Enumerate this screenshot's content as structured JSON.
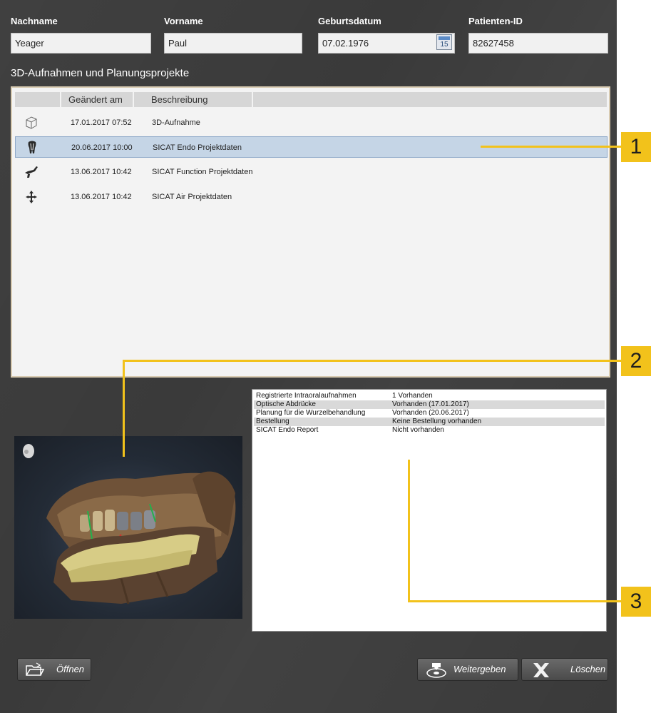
{
  "patient": {
    "lastname_label": "Nachname",
    "lastname_value": "Yeager",
    "firstname_label": "Vorname",
    "firstname_value": "Paul",
    "birthdate_label": "Geburtsdatum",
    "birthdate_value": "07.02.1976",
    "calendar_day": "15",
    "patient_id_label": "Patienten-ID",
    "patient_id_value": "82627458"
  },
  "projects": {
    "title": "3D-Aufnahmen und Planungsprojekte",
    "columns": [
      "Geändert am",
      "Beschreibung"
    ],
    "rows": [
      {
        "icon": "3d-volume-cube-icon",
        "date": "17.01.2017 07:52",
        "description": "3D-Aufnahme",
        "selected": false
      },
      {
        "icon": "tooth-endo-icon",
        "date": "20.06.2017 10:00",
        "description": "SICAT Endo Projektdaten",
        "selected": true
      },
      {
        "icon": "jaw-function-icon",
        "date": "13.06.2017 10:42",
        "description": "SICAT Function Projektdaten",
        "selected": false
      },
      {
        "icon": "air-arrows-icon",
        "date": "13.06.2017 10:42",
        "description": "SICAT Air Projektdaten",
        "selected": false
      }
    ]
  },
  "details": {
    "rows": [
      {
        "key": "Registrierte Intraoralaufnahmen",
        "value": "1 Vorhanden"
      },
      {
        "key": "Optische Abdrücke",
        "value": "Vorhanden (17.01.2017)"
      },
      {
        "key": "Planung für die Wurzelbehandlung",
        "value": "Vorhanden (20.06.2017)"
      },
      {
        "key": "Bestellung",
        "value": "Keine Bestellung vorhanden"
      },
      {
        "key": "SICAT Endo Report",
        "value": "Nicht vorhanden"
      }
    ]
  },
  "buttons": {
    "open": "Öffnen",
    "share": "Weitergeben",
    "delete": "Löschen"
  },
  "callouts": [
    "1",
    "2",
    "3"
  ],
  "colors": {
    "background": "#3a3a3a",
    "selection": "#c5d5e6",
    "callout": "#f2c21b"
  }
}
